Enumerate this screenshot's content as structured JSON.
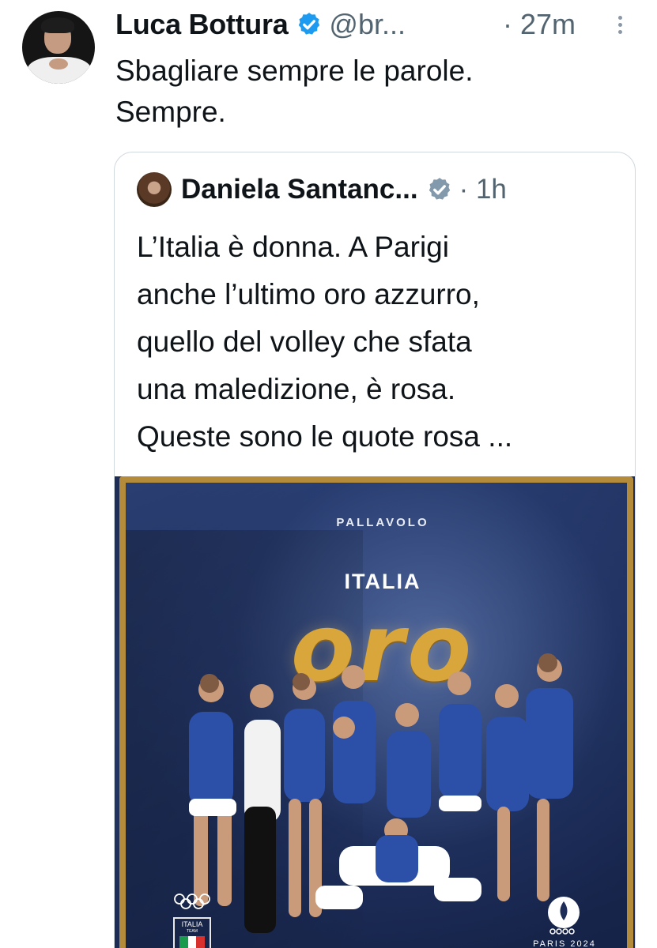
{
  "author": {
    "name": "Luca Bottura",
    "handle": "@br...",
    "time": "· 27m",
    "avatar_icon": "profile-photo",
    "verified_icon": "verified-badge-icon",
    "more_icon": "more-vertical-icon"
  },
  "tweet": {
    "text_line1": "Sbagliare sempre le parole.",
    "text_line2": "Sempre."
  },
  "quote": {
    "name": "Daniela Santanc...",
    "time": "· 1h",
    "verified_icon": "verified-badge-gray-icon",
    "lines": [
      "L’Italia è donna. A Parigi",
      "anche l’ultimo oro azzurro,",
      "quello del volley che sfata",
      "una maledizione, è rosa.",
      "Queste sono le quote rosa ..."
    ],
    "media": {
      "sport": "PALLAVOLO",
      "country": "ITALIA",
      "medal": "oro",
      "team_badge_line1": "ITALIA",
      "team_badge_line2": "TEAM",
      "games_label": "PARIS 2024"
    }
  },
  "colors": {
    "verified_blue": "#1d9bf0",
    "muted": "#536471",
    "gold": "#d8a63a",
    "navy": "#1d2d58"
  }
}
